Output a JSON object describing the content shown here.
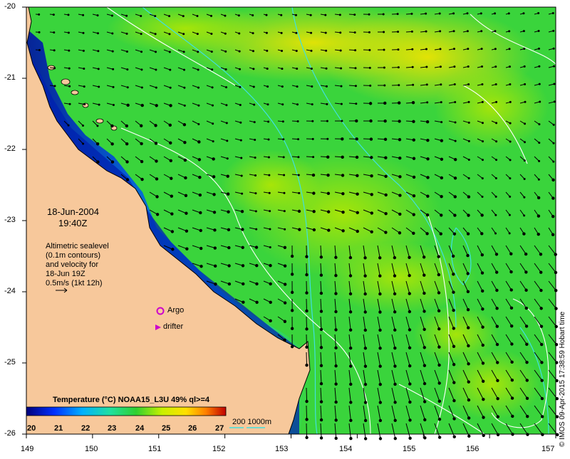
{
  "map": {
    "lon_ticks": [
      "149",
      "150",
      "151",
      "152",
      "153",
      "154",
      "155",
      "156",
      "157"
    ],
    "lat_ticks": [
      "-20",
      "-21",
      "-22",
      "-23",
      "-24",
      "-25",
      "-26"
    ],
    "date": "18-Jun-2004",
    "time": "19:40Z",
    "altimetry_note": [
      "Altimetric sealevel",
      "(0.1m contours)",
      "and velocity for",
      "18-Jun 19Z",
      "0.5m/s (1kt 12h)"
    ],
    "argo_label": "Argo",
    "drifter_label": "drifter",
    "colorbar": {
      "title": "Temperature (°C) NOAA15_L3U 49% ql>=4",
      "ticks": [
        "20",
        "21",
        "22",
        "23",
        "24",
        "25",
        "26",
        "27"
      ]
    },
    "depth_contours_label": "200  1000m",
    "credit": "© IMOS 09-Apr-2015 17:38:59 Hobart time",
    "colors": {
      "land": "#f7c89b",
      "cold": "#00008b",
      "mid": "#2fd03a",
      "warm": "#f0e000",
      "hot": "#e06000",
      "depth_contour": "#40e0e0",
      "sealevel_contour": "#ffffff",
      "marker": "#cc00cc"
    }
  }
}
